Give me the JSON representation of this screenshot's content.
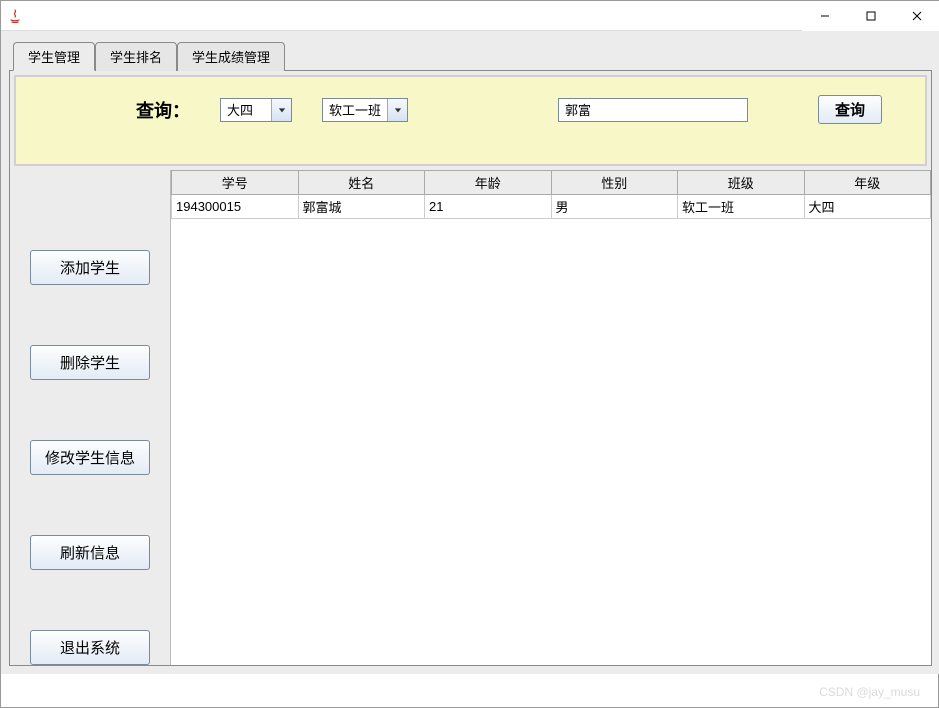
{
  "window": {
    "title": ""
  },
  "titlebar_buttons": {
    "minimize": "minimize",
    "maximize": "maximize",
    "close": "close"
  },
  "tabs": [
    {
      "label": "学生管理",
      "active": true
    },
    {
      "label": "学生排名",
      "active": false
    },
    {
      "label": "学生成绩管理",
      "active": false
    }
  ],
  "query": {
    "label": "查询：",
    "grade_select": "大四",
    "class_select": "软工一班",
    "name_input": "郭富",
    "button": "查询"
  },
  "sidebar": {
    "add": "添加学生",
    "delete": "删除学生",
    "edit": "修改学生信息",
    "refresh": "刷新信息",
    "exit": "退出系统"
  },
  "table": {
    "headers": [
      "学号",
      "姓名",
      "年龄",
      "性别",
      "班级",
      "年级"
    ],
    "rows": [
      {
        "id": "194300015",
        "name": "郭富城",
        "age": "21",
        "gender": "男",
        "class": "软工一班",
        "grade": "大四"
      }
    ]
  },
  "watermark": "CSDN @jay_musu"
}
